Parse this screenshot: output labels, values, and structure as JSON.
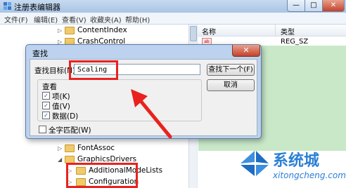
{
  "window": {
    "title": "注册表编辑器",
    "min_label": "—",
    "max_label": "□",
    "close_label": "✕"
  },
  "menu": [
    "文件(F)",
    "编辑(E)",
    "查看(V)",
    "收藏夹(A)",
    "帮助(H)"
  ],
  "tree": {
    "items": [
      {
        "label": "ContentIndex"
      },
      {
        "label": "CrashControl"
      },
      {
        "label": "FontAssoc"
      },
      {
        "label": "GraphicsDrivers"
      },
      {
        "label": "AdditionalModeLists"
      },
      {
        "label": "Configuration"
      }
    ]
  },
  "list": {
    "col_name": "名称",
    "col_type": "类型",
    "row_type": "REG_SZ",
    "row_icon_text": "ab"
  },
  "find_dialog": {
    "title": "查找",
    "close_label": "✕",
    "find_what_label": "查找目标(N):",
    "find_value": "Scaling",
    "find_next_label": "查找下一个(F)",
    "cancel_label": "取消",
    "look_at_label": "查看",
    "opt_keys": "项(K)",
    "opt_values": "值(V)",
    "opt_data": "数据(D)",
    "opt_whole": "全字匹配(W)",
    "checked": "✓"
  },
  "watermark": {
    "brand": "系统城",
    "url": "xitongcheng.com"
  },
  "colors": {
    "annotation_red": "#e8231f",
    "list_highlight": "#c8e8c8"
  }
}
